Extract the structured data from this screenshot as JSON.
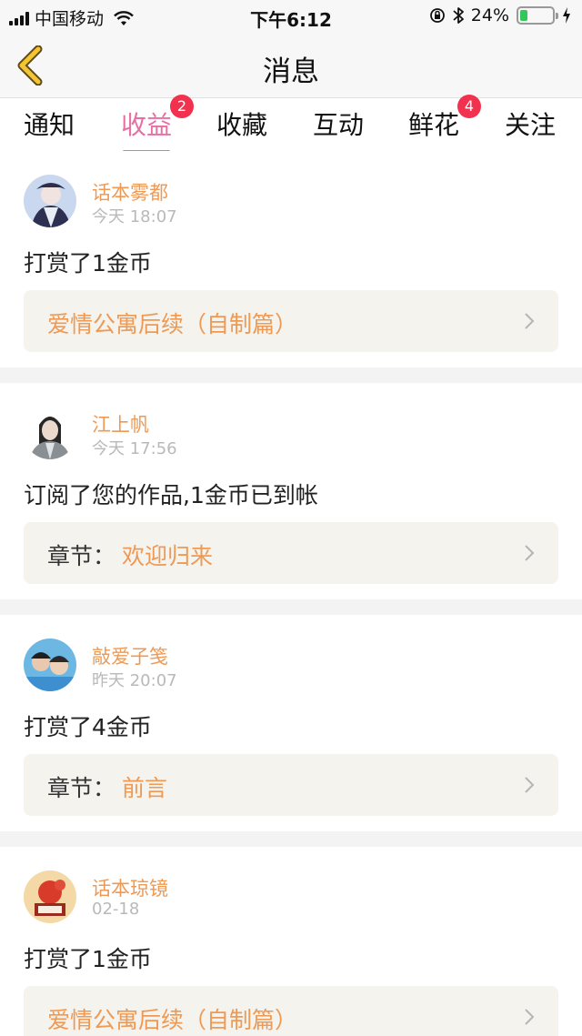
{
  "status_bar": {
    "carrier": "中国移动",
    "time": "下午6:12",
    "battery": "24%",
    "battery_level": 0.24
  },
  "header": {
    "title": "消息"
  },
  "tabs": [
    {
      "label": "通知",
      "badge": ""
    },
    {
      "label": "收益",
      "badge": "2",
      "active": true
    },
    {
      "label": "收藏",
      "badge": ""
    },
    {
      "label": "互动",
      "badge": ""
    },
    {
      "label": "鲜花",
      "badge": "4"
    },
    {
      "label": "关注",
      "badge": ""
    }
  ],
  "messages": [
    {
      "user": "话本雾都",
      "time": "今天 18:07",
      "action": "打赏了1金币",
      "link_prefix": "",
      "link": "爱情公寓后续（自制篇）"
    },
    {
      "user": "江上帆",
      "time": "今天 17:56",
      "action": "订阅了您的作品,1金币已到帐",
      "link_prefix": "章节：",
      "link": "欢迎归来"
    },
    {
      "user": "敲爱子笺",
      "time": "昨天 20:07",
      "action": "打赏了4金币",
      "link_prefix": "章节：",
      "link": "前言"
    },
    {
      "user": "话本琼镜",
      "time": "02-18",
      "action": "打赏了1金币",
      "link_prefix": "",
      "link": "爱情公寓后续（自制篇）"
    }
  ],
  "colors": {
    "accent": "#e86fa6",
    "username": "#ee9a55",
    "badge": "#f1314d",
    "back_arrow": "#f4c531"
  },
  "icons": {
    "back": "back-arrow-icon",
    "chevron": "chevron-right-icon",
    "wifi": "wifi-icon",
    "lock": "rotation-lock-icon",
    "bluetooth": "bluetooth-icon",
    "charging": "charging-bolt-icon"
  }
}
